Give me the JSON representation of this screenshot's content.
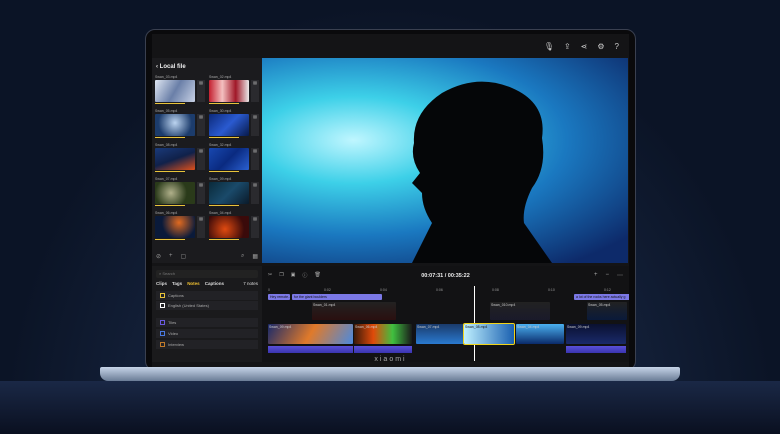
{
  "brand": "xiaomi",
  "top_icons": [
    "microphone-icon",
    "share-icon",
    "connect-icon",
    "settings-icon",
    "help-icon"
  ],
  "library": {
    "title": "Local file",
    "clips": [
      {
        "name": "Swan_03.mp4",
        "thumb": "linear-gradient(120deg,#dfe6f2,#6a7fa8,#c8d2e6)"
      },
      {
        "name": "Swan_02.mp4",
        "thumb": "linear-gradient(90deg,#c42030,#f4c0c0,#a01828,#eaeaea)"
      },
      {
        "name": "Swan_05.mp4",
        "thumb": "radial-gradient(circle at 50% 40%,#bcd4f0,#1c3c6c 70%)"
      },
      {
        "name": "Swan_30.mp4",
        "thumb": "linear-gradient(135deg,#0c2a7a,#2a5ad0,#071a4a)"
      },
      {
        "name": "Swan_08.mp4",
        "thumb": "linear-gradient(160deg,#1a3a7a,#10214a 50%,#e0501a)"
      },
      {
        "name": "Swan_32.mp4",
        "thumb": "linear-gradient(135deg,#1848b0,#0a2a80,#2a60d0)"
      },
      {
        "name": "Swan_07.mp4",
        "thumb": "radial-gradient(circle at 40% 50%,#b0b08a,#2a3a1a 60%)"
      },
      {
        "name": "Swan_09.mp4",
        "thumb": "linear-gradient(135deg,#0a2a3a,#1a4a6a,#0a1a2a)"
      },
      {
        "name": "Swan_06.mp4",
        "thumb": "radial-gradient(circle at 60% 30%,#e06a20,#0a1a3a 60%)"
      },
      {
        "name": "Swan_04.mp4",
        "thumb": "radial-gradient(circle at 40% 60%,#e04a10,#3a0a0a 70%)"
      }
    ]
  },
  "notes": {
    "search_placeholder": "Search",
    "tabs": [
      "Clips",
      "Tags",
      "Notes",
      "Captions"
    ],
    "active_tab": "Notes",
    "count": "7 notes",
    "rows": [
      {
        "label": "Captions",
        "color": "#e8c33a"
      },
      {
        "label": "English (United States)",
        "color": "#ffffff"
      }
    ],
    "tags": [
      {
        "label": "Tiles",
        "color": "#6a5ae0"
      },
      {
        "label": "Video",
        "color": "#4a7ae0"
      },
      {
        "label": "Interview",
        "color": "#c07a2a"
      }
    ]
  },
  "timeline": {
    "time": "00:07:31 / 00:35:22",
    "ruler": [
      "0",
      "0:02",
      "0:04",
      "0:06",
      "0:08",
      "0:10",
      "0:12"
    ],
    "captions": [
      "Hey remote...",
      "for the giant boulders",
      "a lot of the rocks here actually g"
    ],
    "overlay_clips": [
      "Swan_01.mp4",
      "Swan_010.mp4",
      "Swan_05.mp4"
    ],
    "clips": [
      "Swan_09.mp4",
      "Swan_06.mp4",
      "Swan_07.mp4",
      "Swan_08.mp4",
      "Swan_04.mp4",
      "Swan_09.mp4"
    ],
    "selected_clip": "Swan_08.mp4"
  }
}
